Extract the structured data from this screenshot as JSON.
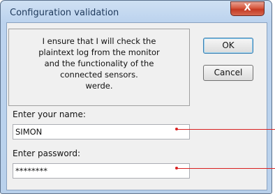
{
  "window": {
    "title": "Configuration validation",
    "close_label": "X"
  },
  "message": {
    "lines": [
      "I ensure that I will check the",
      "plaintext log from the monitor",
      "and the functionality of the",
      "connected sensors.",
      "werde."
    ]
  },
  "buttons": {
    "ok_label": "OK",
    "cancel_label": "Cancel"
  },
  "form": {
    "name_label": "Enter your name:",
    "name_value": "SIMON",
    "password_label": "Enter password:",
    "password_value": "********"
  },
  "colors": {
    "annotation_marker": "#d92020"
  }
}
